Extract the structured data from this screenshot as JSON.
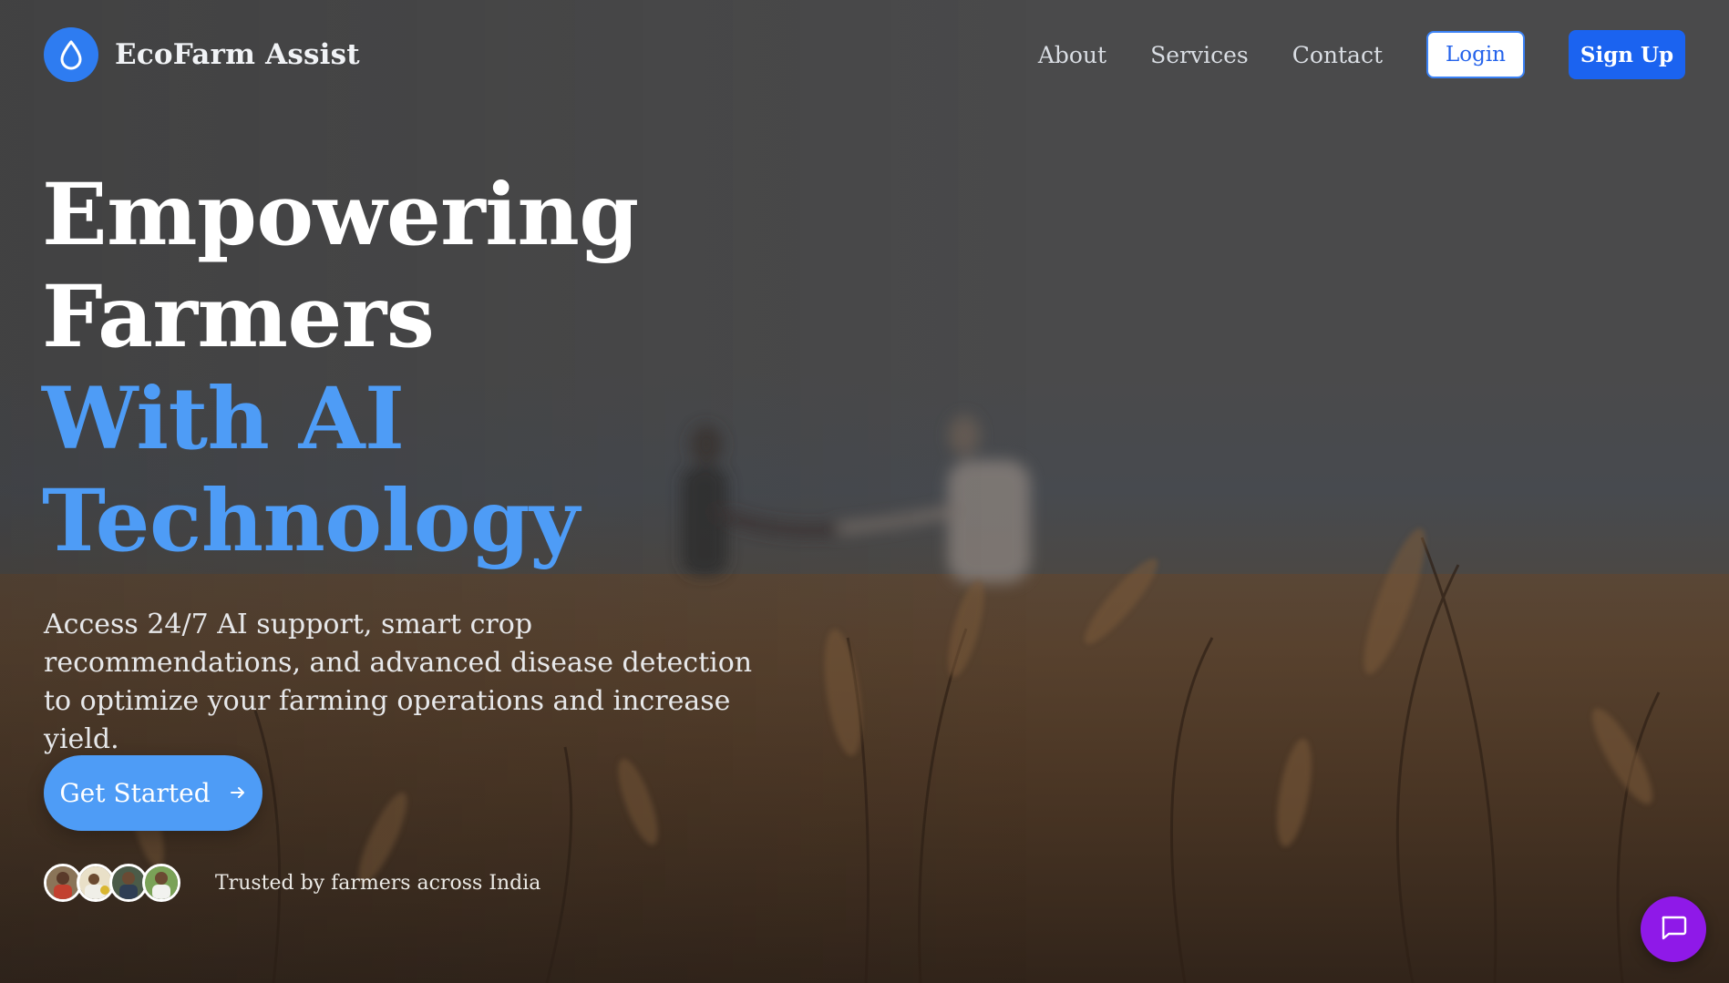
{
  "brand": {
    "name": "EcoFarm Assist",
    "logo_icon": "water-drop-icon"
  },
  "nav": {
    "links": [
      "About",
      "Services",
      "Contact"
    ],
    "login_label": "Login",
    "signup_label": "Sign Up"
  },
  "hero": {
    "title_lines": [
      "Empowering",
      "Farmers"
    ],
    "highlight_lines": [
      "With AI",
      "Technology"
    ],
    "subtitle": "Access 24/7 AI support, smart crop recommendations, and advanced disease detection to optimize your farming operations and increase yield.",
    "cta_label": "Get Started",
    "cta_icon": "arrow-right-icon"
  },
  "trust": {
    "text": "Trusted by farmers across India",
    "avatar_count": 4
  },
  "chat": {
    "icon": "chat-bubble-icon"
  },
  "colors": {
    "primary": "#1b63f0",
    "accent_blue": "#4e9cf6",
    "chat_purple": "#8f19e8"
  }
}
